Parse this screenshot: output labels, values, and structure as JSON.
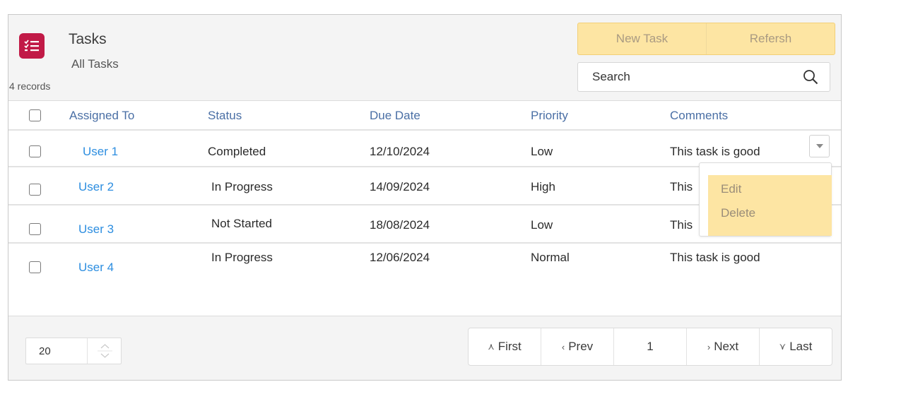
{
  "header": {
    "title": "Tasks",
    "subtitle": "All Tasks",
    "record_count": "4 records",
    "icon": "task-list-icon",
    "brand_color": "#c11a47"
  },
  "toolbar": {
    "new_task_label": "New Task",
    "refresh_label": "Refersh"
  },
  "search": {
    "placeholder": "Search",
    "icon": "search-icon"
  },
  "table": {
    "columns": [
      "Assigned To",
      "Status",
      "Due Date",
      "Priority",
      "Comments"
    ],
    "rows": [
      {
        "assigned_to": "User 1",
        "status": "Completed",
        "due_date": "12/10/2024",
        "priority": "Low",
        "comments": "This task is good"
      },
      {
        "assigned_to": "User 2",
        "status": "In Progress",
        "due_date": "14/09/2024",
        "priority": "High",
        "comments": "This"
      },
      {
        "assigned_to": "User 3",
        "status": "Not Started",
        "due_date": "18/08/2024",
        "priority": "Low",
        "comments": "This"
      },
      {
        "assigned_to": "User 4",
        "status": "In Progress",
        "due_date": "12/06/2024",
        "priority": "Normal",
        "comments": "This task is good"
      }
    ]
  },
  "row_menu": {
    "items": [
      "Edit",
      "Delete"
    ],
    "icon": "chevron-down-icon"
  },
  "footer": {
    "page_size": "20",
    "pagination": {
      "first": "First",
      "prev": "Prev",
      "page": "1",
      "next": "Next",
      "last": "Last"
    }
  },
  "colors": {
    "accent_yellow": "#fde5a3",
    "link_blue": "#2d8ee0",
    "header_blue": "#4a6fa5"
  }
}
